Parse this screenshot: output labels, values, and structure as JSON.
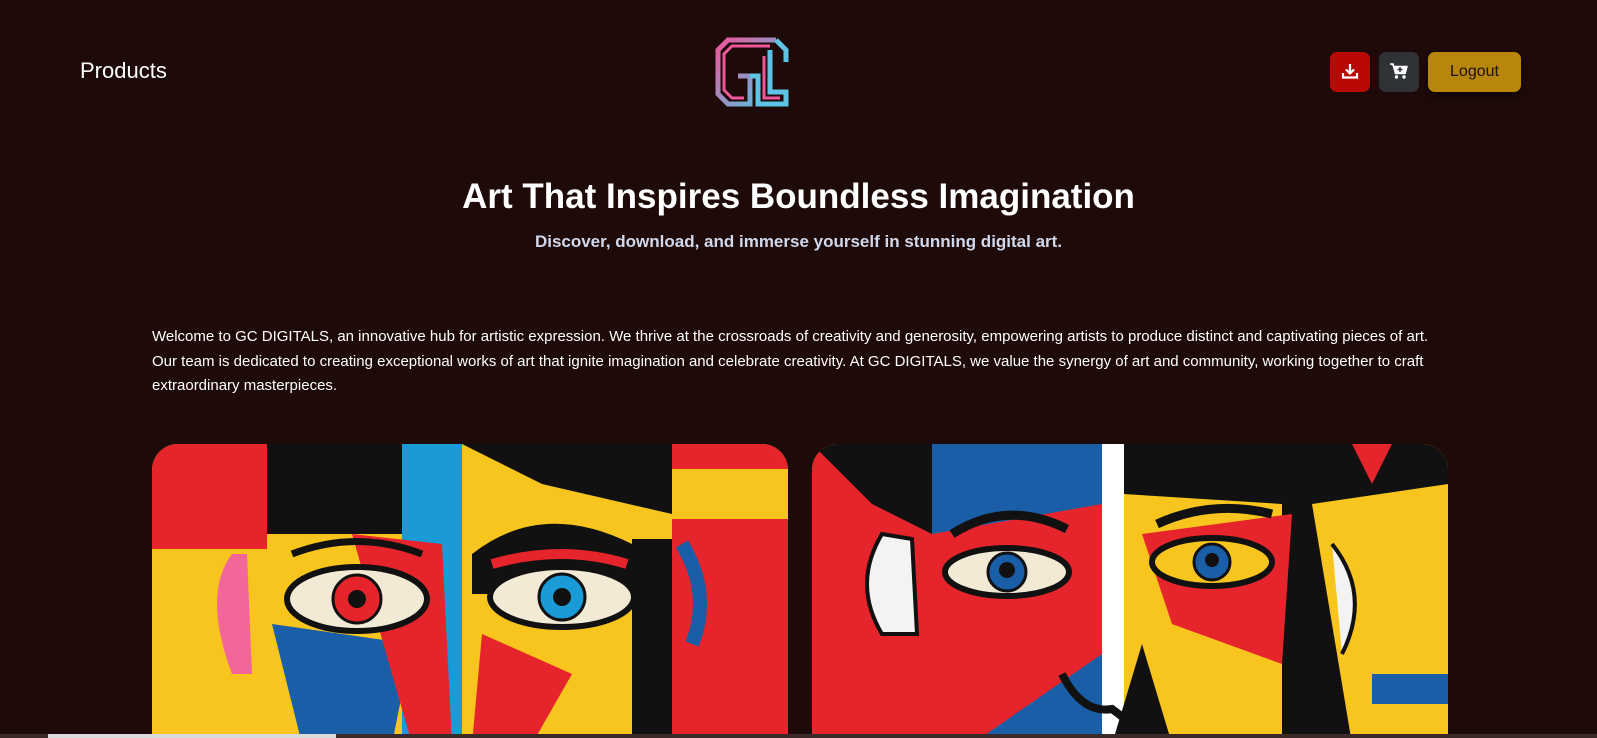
{
  "header": {
    "nav_label": "Products",
    "logo_icon": "gc-logo-icon",
    "download_icon": "download-icon",
    "cart_icon": "cart-icon",
    "logout_label": "Logout"
  },
  "hero": {
    "title": "Art That Inspires Boundless Imagination",
    "subtitle": "Discover, download, and immerse yourself in stunning digital art."
  },
  "intro": {
    "text": "Welcome to GC DIGITALS, an innovative hub for artistic expression. We thrive at the crossroads of creativity and generosity, empowering artists to produce distinct and captivating pieces of art. Our team is dedicated to creating exceptional works of art that ignite imagination and celebrate creativity. At GC DIGITALS, we value the synergy of art and community, working together to craft extraordinary masterpieces."
  },
  "colors": {
    "background": "#1e0a09",
    "download_button": "#b90805",
    "cart_button": "#2f3236",
    "logout_button": "#b8860b",
    "art_red": "#e5242b",
    "art_yellow": "#f7c51e",
    "art_blue": "#1b5ea8",
    "art_black": "#111111"
  }
}
